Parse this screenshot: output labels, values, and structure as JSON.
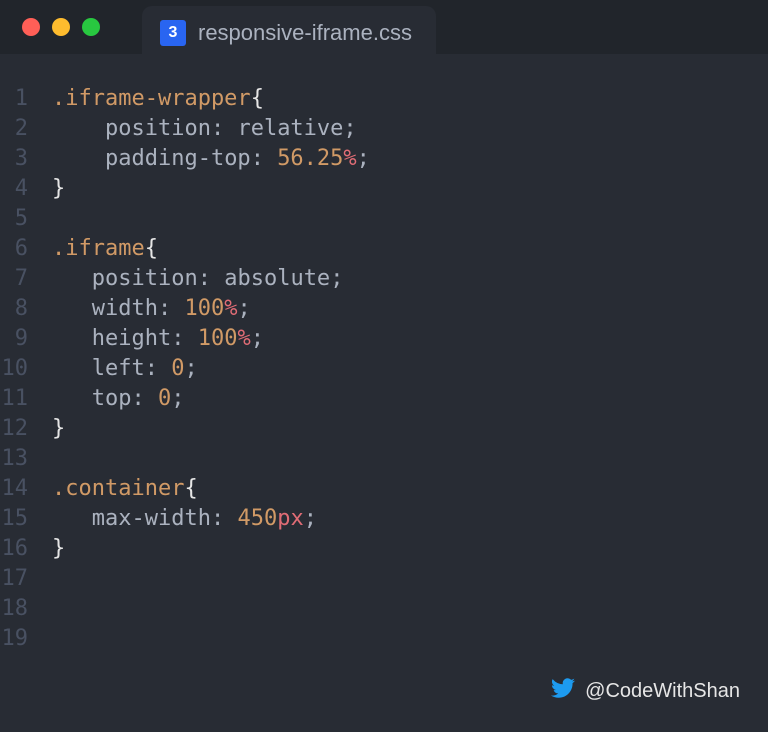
{
  "tab": {
    "filename": "responsive-iframe.css",
    "icon_label": "3"
  },
  "attribution": {
    "handle": "@CodeWithShan"
  },
  "code": {
    "lines": [
      {
        "n": "1",
        "tokens": [
          {
            "c": "sel",
            "t": ".iframe-wrapper"
          },
          {
            "c": "white",
            "t": "{"
          }
        ]
      },
      {
        "n": "2",
        "indent": "    ",
        "tokens": [
          {
            "c": "prop",
            "t": "position"
          },
          {
            "c": "punct",
            "t": ": "
          },
          {
            "c": "val-kw",
            "t": "relative"
          },
          {
            "c": "punct",
            "t": ";"
          }
        ]
      },
      {
        "n": "3",
        "indent": "    ",
        "tokens": [
          {
            "c": "prop",
            "t": "padding-top"
          },
          {
            "c": "punct",
            "t": ": "
          },
          {
            "c": "num",
            "t": "56.25"
          },
          {
            "c": "unit",
            "t": "%"
          },
          {
            "c": "punct",
            "t": ";"
          }
        ]
      },
      {
        "n": "4",
        "tokens": [
          {
            "c": "white",
            "t": "}"
          }
        ]
      },
      {
        "n": "5",
        "tokens": []
      },
      {
        "n": "6",
        "tokens": [
          {
            "c": "sel",
            "t": ".iframe"
          },
          {
            "c": "white",
            "t": "{"
          }
        ]
      },
      {
        "n": "7",
        "indent": "   ",
        "tokens": [
          {
            "c": "prop",
            "t": "position"
          },
          {
            "c": "punct",
            "t": ": "
          },
          {
            "c": "val-kw",
            "t": "absolute"
          },
          {
            "c": "punct",
            "t": ";"
          }
        ]
      },
      {
        "n": "8",
        "indent": "   ",
        "tokens": [
          {
            "c": "prop",
            "t": "width"
          },
          {
            "c": "punct",
            "t": ": "
          },
          {
            "c": "num",
            "t": "100"
          },
          {
            "c": "unit",
            "t": "%"
          },
          {
            "c": "punct",
            "t": ";"
          }
        ]
      },
      {
        "n": "9",
        "indent": "   ",
        "tokens": [
          {
            "c": "prop",
            "t": "height"
          },
          {
            "c": "punct",
            "t": ": "
          },
          {
            "c": "num",
            "t": "100"
          },
          {
            "c": "unit",
            "t": "%"
          },
          {
            "c": "punct",
            "t": ";"
          }
        ]
      },
      {
        "n": "10",
        "indent": "   ",
        "tokens": [
          {
            "c": "prop",
            "t": "left"
          },
          {
            "c": "punct",
            "t": ": "
          },
          {
            "c": "num",
            "t": "0"
          },
          {
            "c": "punct",
            "t": ";"
          }
        ]
      },
      {
        "n": "11",
        "indent": "   ",
        "tokens": [
          {
            "c": "prop",
            "t": "top"
          },
          {
            "c": "punct",
            "t": ": "
          },
          {
            "c": "num",
            "t": "0"
          },
          {
            "c": "punct",
            "t": ";"
          }
        ]
      },
      {
        "n": "12",
        "tokens": [
          {
            "c": "white",
            "t": "}"
          }
        ]
      },
      {
        "n": "13",
        "tokens": []
      },
      {
        "n": "14",
        "tokens": [
          {
            "c": "sel",
            "t": ".container"
          },
          {
            "c": "white",
            "t": "{"
          }
        ]
      },
      {
        "n": "15",
        "indent": "   ",
        "tokens": [
          {
            "c": "prop",
            "t": "max-width"
          },
          {
            "c": "punct",
            "t": ": "
          },
          {
            "c": "num",
            "t": "450"
          },
          {
            "c": "unit",
            "t": "px"
          },
          {
            "c": "punct",
            "t": ";"
          }
        ]
      },
      {
        "n": "16",
        "tokens": [
          {
            "c": "white",
            "t": "}"
          }
        ]
      },
      {
        "n": "17",
        "tokens": []
      },
      {
        "n": "18",
        "tokens": []
      },
      {
        "n": "19",
        "tokens": []
      }
    ]
  }
}
